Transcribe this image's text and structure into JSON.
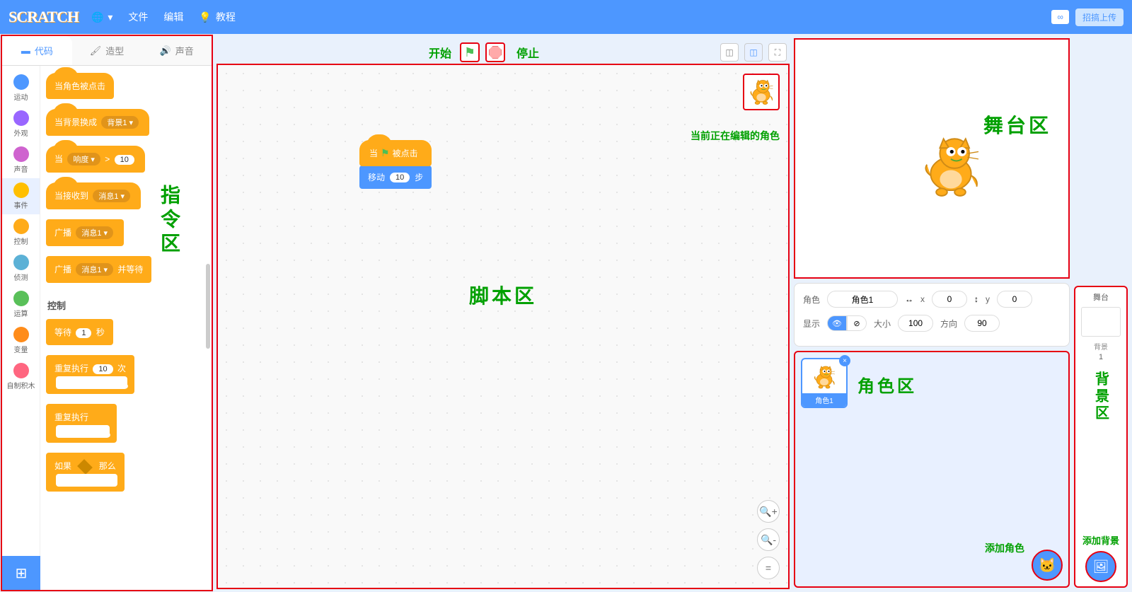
{
  "menu": {
    "logo": "SCRATCH",
    "lang_dd": "▾",
    "file": "文件",
    "edit": "编辑",
    "tutorials": "教程",
    "upload": "招搞上传"
  },
  "tabs": {
    "code": "代码",
    "costumes": "造型",
    "sounds": "声音"
  },
  "categories": [
    {
      "name": "运动",
      "color": "#4d97ff"
    },
    {
      "name": "外观",
      "color": "#9966ff"
    },
    {
      "name": "声音",
      "color": "#cf63cf"
    },
    {
      "name": "事件",
      "color": "#ffbf00"
    },
    {
      "name": "控制",
      "color": "#ffab19"
    },
    {
      "name": "侦测",
      "color": "#5cb1d6"
    },
    {
      "name": "运算",
      "color": "#59c059"
    },
    {
      "name": "变量",
      "color": "#ff8c1a"
    },
    {
      "name": "自制积木",
      "color": "#ff6680"
    }
  ],
  "active_category_index": 3,
  "palette": {
    "events": {
      "when_clicked": "当角色被点击",
      "when_backdrop": "当背景换成",
      "backdrop_opt": "背景1 ▾",
      "when_loudness": "当",
      "loudness_opt": "响度 ▾",
      "loudness_gt": ">",
      "loudness_val": "10",
      "when_receive": "当接收到",
      "msg_opt": "消息1 ▾",
      "broadcast": "广播",
      "broadcast_wait": "广播",
      "and_wait": "并等待"
    },
    "control_title": "控制",
    "control": {
      "wait": "等待",
      "wait_val": "1",
      "wait_unit": "秒",
      "repeat": "重复执行",
      "repeat_val": "10",
      "repeat_unit": "次",
      "forever": "重复执行",
      "if": "如果",
      "then": "那么"
    }
  },
  "annotations": {
    "instruction_area": "指令区",
    "script_area": "脚本区",
    "start": "开始",
    "stop": "停止",
    "current_sprite": "当前正在编辑的角色",
    "stage_area": "舞台区",
    "sprite_area": "角色区",
    "add_sprite": "添加角色",
    "bg_area": "背景区",
    "add_bg": "添加背景"
  },
  "script": {
    "hat_when": "当",
    "hat_clicked": "被点击",
    "move": "移动",
    "move_val": "10",
    "move_unit": "步"
  },
  "sprite_info": {
    "name_label": "角色",
    "name": "角色1",
    "x_label": "x",
    "x": "0",
    "y_label": "y",
    "y": "0",
    "show_label": "显示",
    "size_label": "大小",
    "size": "100",
    "dir_label": "方向",
    "dir": "90"
  },
  "sprite_card": {
    "name": "角色1"
  },
  "stage_panel": {
    "title": "舞台",
    "bg_label": "背景",
    "bg_count": "1"
  }
}
